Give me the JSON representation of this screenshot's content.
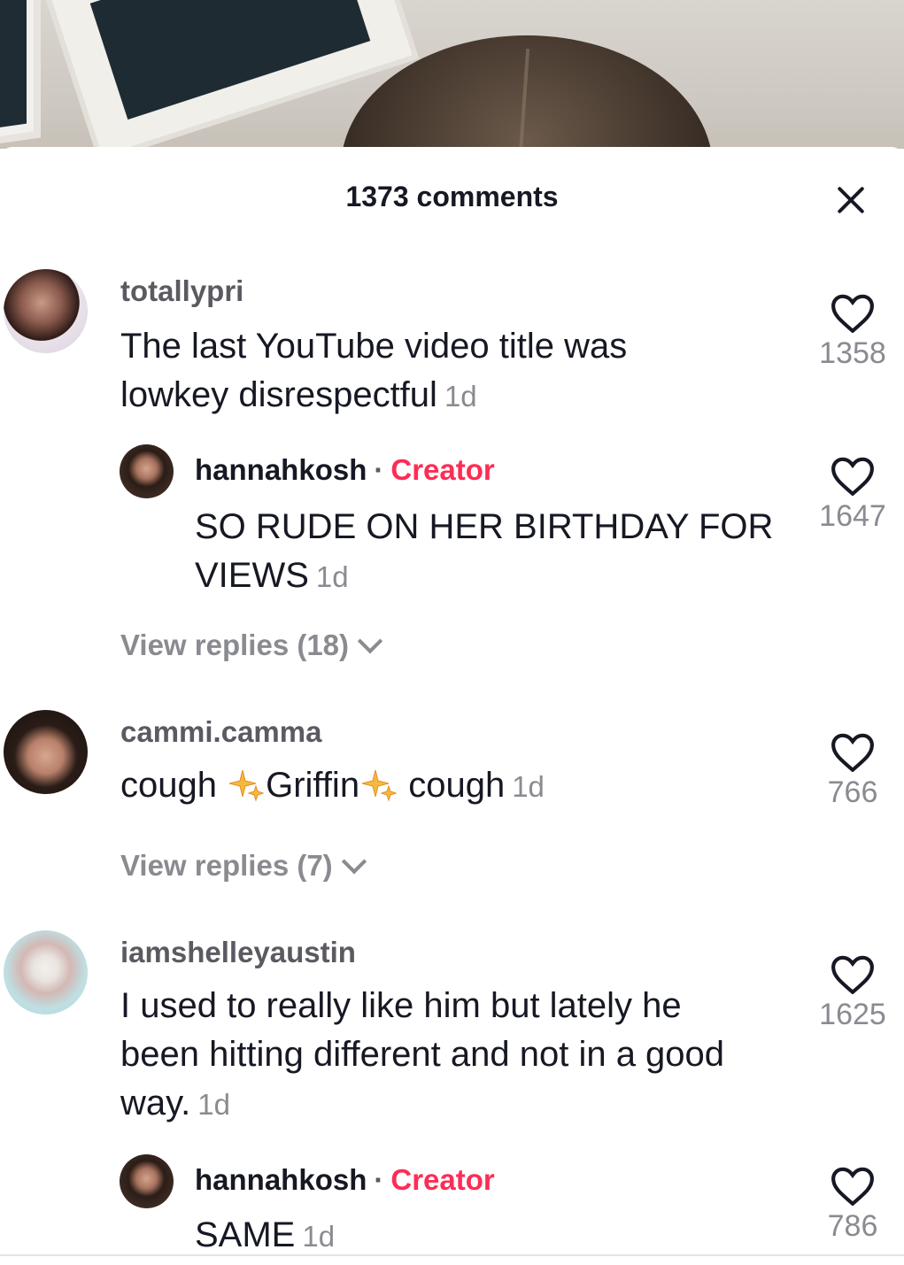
{
  "header": {
    "title": "1373 comments"
  },
  "comments": [
    {
      "username": "totallypri",
      "text": "The last YouTube video title was lowkey disrespectful",
      "time": "1d",
      "likes": "1358",
      "reply": {
        "username": "hannahkosh",
        "badge": "Creator",
        "text": "SO RUDE ON HER BIRTHDAY FOR VIEWS",
        "time": "1d",
        "likes": "1647"
      },
      "view_replies": "View replies (18)"
    },
    {
      "username": "cammi.camma",
      "text_before": "cough",
      "text_middle": "Griffin",
      "text_after": "cough",
      "time": "1d",
      "likes": "766",
      "view_replies": "View replies (7)"
    },
    {
      "username": "iamshelleyaustin",
      "text": "I used to really like him but lately he been hitting different and not in a good way.",
      "time": "1d",
      "likes": "1625",
      "reply": {
        "username": "hannahkosh",
        "badge": "Creator",
        "text": "SAME",
        "time": "1d",
        "likes": "786"
      }
    }
  ],
  "colors": {
    "creator": "#fe2c55",
    "text": "#161823",
    "muted": "#8a8b91"
  },
  "icons": [
    "close-icon",
    "heart-outline-icon",
    "chevron-down-icon",
    "sparkles-emoji"
  ]
}
